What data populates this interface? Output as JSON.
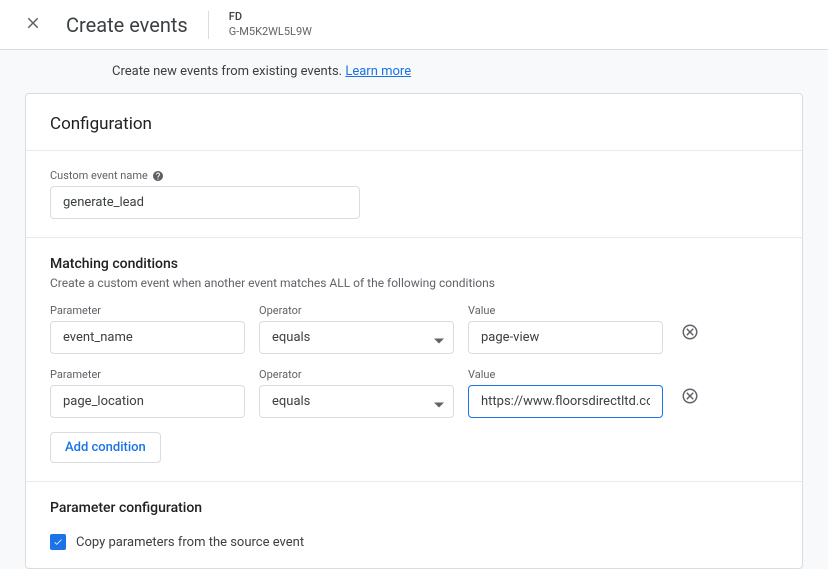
{
  "header": {
    "title": "Create events",
    "propertyLabel": "FD",
    "propertyId": "G-M5K2WL5L9W"
  },
  "intro": {
    "text": "Create new events from existing events.",
    "linkText": "Learn more"
  },
  "card": {
    "title": "Configuration",
    "customEvent": {
      "label": "Custom event name",
      "value": "generate_lead"
    },
    "matching": {
      "title": "Matching conditions",
      "desc": "Create a custom event when another event matches ALL of the following conditions",
      "labels": {
        "parameter": "Parameter",
        "operator": "Operator",
        "value": "Value"
      },
      "rows": [
        {
          "parameter": "event_name",
          "operator": "equals",
          "value": "page-view",
          "active": false
        },
        {
          "parameter": "page_location",
          "operator": "equals",
          "value": "https://www.floorsdirectltd.co.uk/con",
          "active": true
        }
      ],
      "addLabel": "Add condition"
    },
    "paramConfig": {
      "title": "Parameter configuration",
      "copyLabel": "Copy parameters from the source event",
      "copyChecked": true
    }
  }
}
